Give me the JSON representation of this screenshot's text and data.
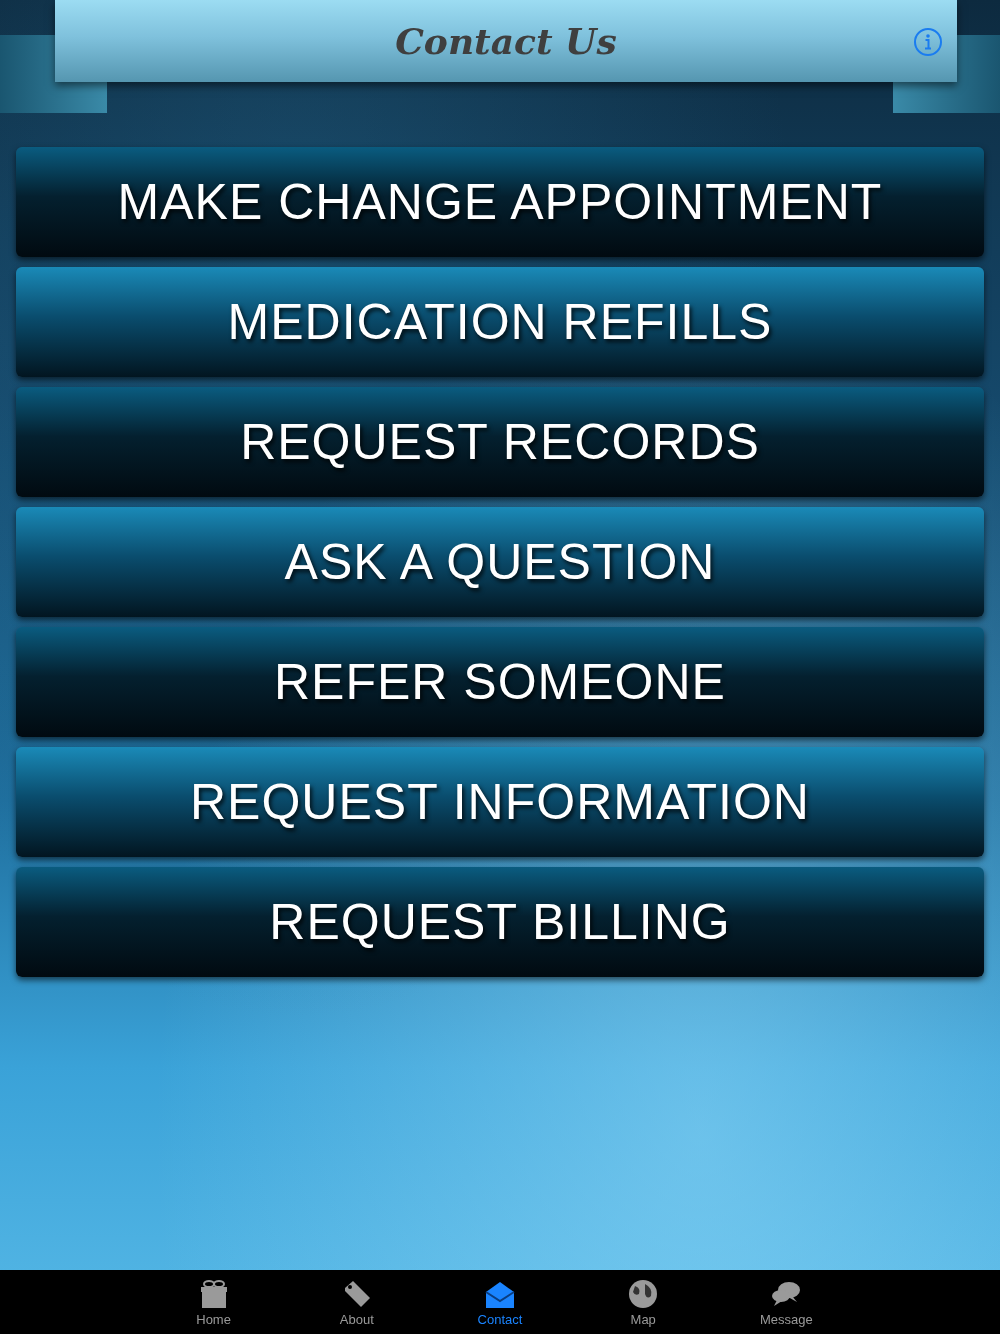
{
  "header": {
    "title": "Contact Us"
  },
  "buttons": [
    {
      "label": "MAKE CHANGE APPOINTMENT"
    },
    {
      "label": "MEDICATION REFILLS"
    },
    {
      "label": "REQUEST RECORDS"
    },
    {
      "label": "ASK A QUESTION"
    },
    {
      "label": "REFER SOMEONE"
    },
    {
      "label": "REQUEST INFORMATION"
    },
    {
      "label": "REQUEST BILLING"
    }
  ],
  "tab_bar": [
    {
      "label": "Home",
      "selected": false
    },
    {
      "label": "About",
      "selected": false
    },
    {
      "label": "Contact",
      "selected": true
    },
    {
      "label": "Map",
      "selected": false
    },
    {
      "label": "Message",
      "selected": false
    }
  ]
}
